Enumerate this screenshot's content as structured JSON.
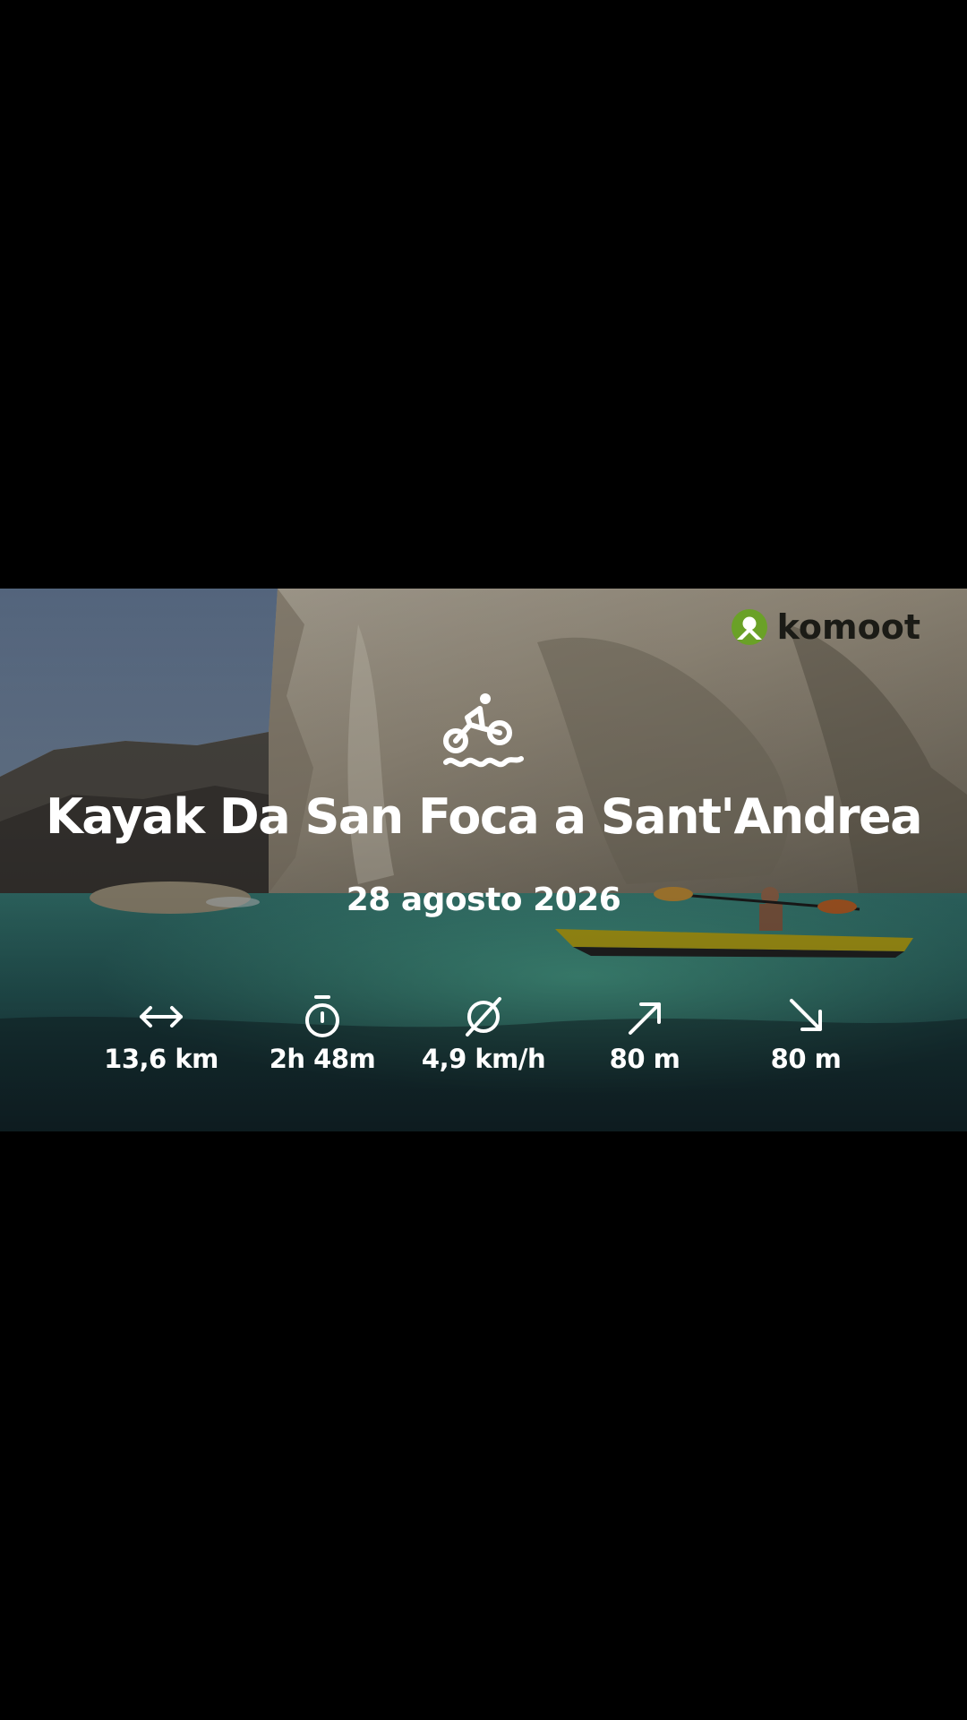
{
  "brand": {
    "name": "komoot",
    "accent": "#6aa127",
    "logo_icon": "komoot-logo-icon"
  },
  "tour": {
    "sport_icon": "bike-and-water-icon",
    "title": "Kayak Da San Foca a Sant'Andrea",
    "date": "28 agosto 2026"
  },
  "stats": [
    {
      "icon": "distance-arrows-icon",
      "value": "13,6 km"
    },
    {
      "icon": "stopwatch-icon",
      "value": "2h 48m"
    },
    {
      "icon": "average-speed-icon",
      "value": "4,9 km/h"
    },
    {
      "icon": "ascent-arrow-icon",
      "value": "80 m"
    },
    {
      "icon": "descent-arrow-icon",
      "value": "80 m"
    }
  ]
}
